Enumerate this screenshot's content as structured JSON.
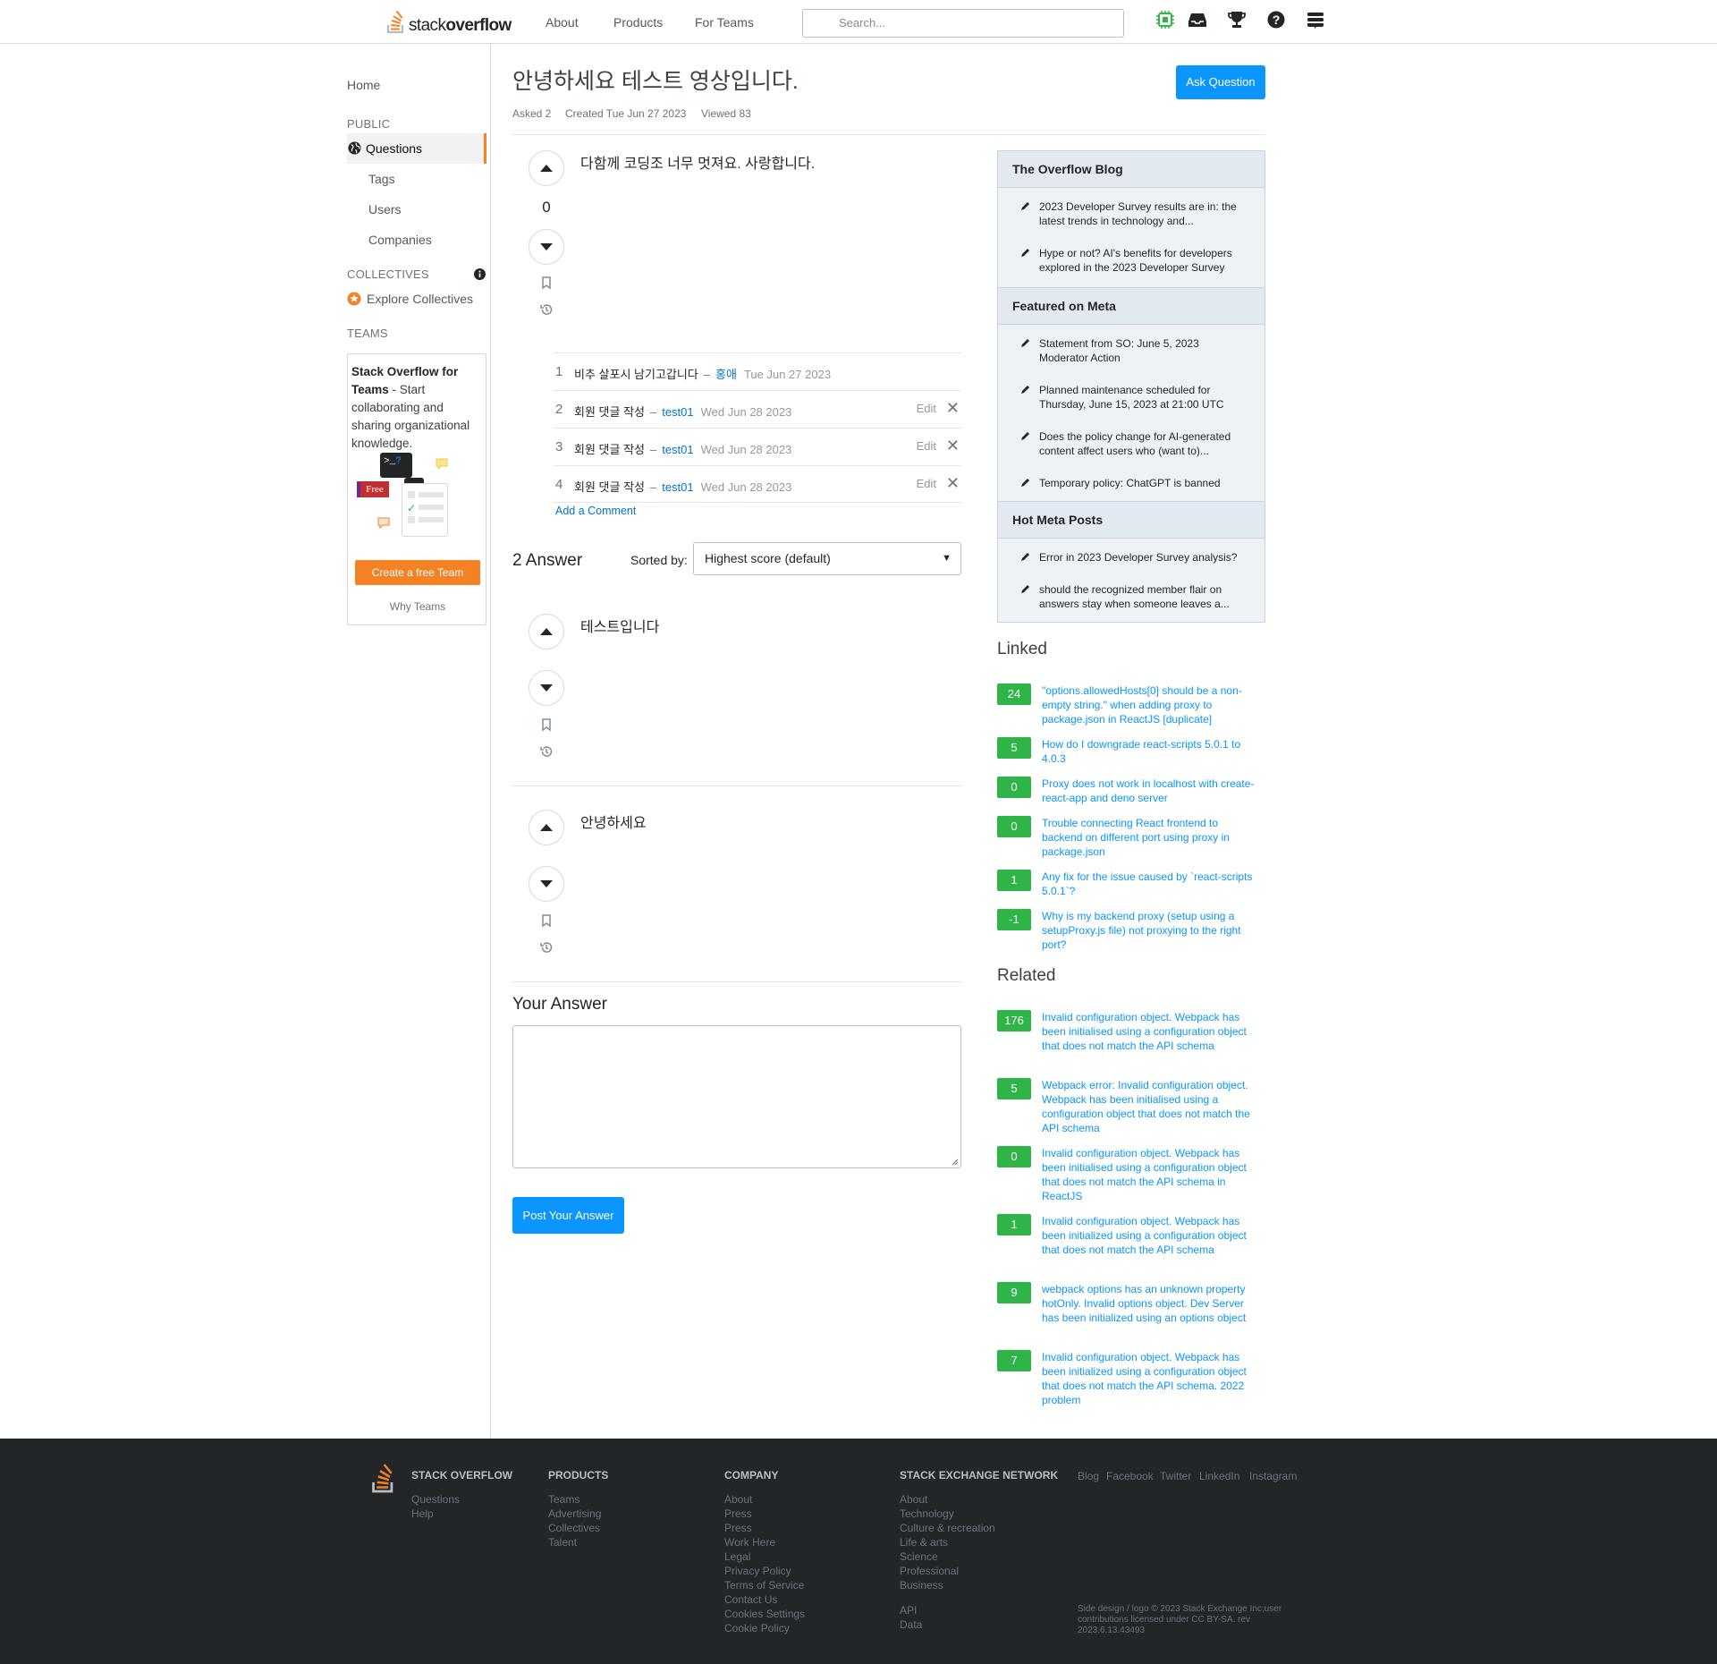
{
  "header": {
    "logo_text_light": "stack",
    "logo_text_bold": "overflow",
    "nav": [
      "About",
      "Products",
      "For Teams"
    ],
    "search_placeholder": "Search..."
  },
  "leftnav": {
    "home": "Home",
    "public": "PUBLIC",
    "questions": "Questions",
    "tags": "Tags",
    "users": "Users",
    "companies": "Companies",
    "collectives": "COLLECTIVES",
    "explore_collectives": "Explore Collectives",
    "teams": "TEAMS",
    "teams_title": "Stack Overflow for Teams",
    "teams_desc": " - Start collaborating and sharing organizational knowledge.",
    "free_badge": "Free",
    "create_team": "Create a free Team",
    "why_teams": "Why Teams"
  },
  "question": {
    "title": "안녕하세요 테스트 영상입니다.",
    "asked": "Asked 2",
    "created": "Created Tue Jun 27 2023",
    "viewed": "Viewed 83",
    "ask_button": "Ask Question",
    "votes": "0",
    "body": "다함께 코딩조 너무 멋져요. 사랑합니다."
  },
  "comments": [
    {
      "num": "1",
      "text": "비추 살포시 남기고갑니다",
      "user": "홍애",
      "date": "Tue Jun 27 2023",
      "edit": "",
      "close": ""
    },
    {
      "num": "2",
      "text": "회원 댓글 작성",
      "user": "test01",
      "date": "Wed Jun 28 2023",
      "edit": "Edit",
      "close": "✕"
    },
    {
      "num": "3",
      "text": "회원 댓글 작성",
      "user": "test01",
      "date": "Wed Jun 28 2023",
      "edit": "Edit",
      "close": "✕"
    },
    {
      "num": "4",
      "text": "회원 댓글 작성",
      "user": "test01",
      "date": "Wed Jun 28 2023",
      "edit": "Edit",
      "close": "✕"
    }
  ],
  "comment_separator": "–",
  "add_comment": "Add a Comment",
  "answers_section": {
    "count_label": "2 Answer",
    "sorted_by": "Sorted by:",
    "sort_value": "Highest score (default)",
    "answers": [
      {
        "body": "테스트입니다"
      },
      {
        "body": "안녕하세요"
      }
    ]
  },
  "your_answer": {
    "heading": "Your Answer",
    "post_button": "Post Your Answer"
  },
  "sidebar": {
    "blog_title": "The Overflow Blog",
    "blog_items": [
      "2023 Developer Survey results are in: the latest trends in technology and...",
      "Hype or not? AI's benefits for developers explored in the 2023 Developer Survey"
    ],
    "meta_title": "Featured on Meta",
    "meta_items": [
      "Statement from SO: June 5, 2023 Moderator Action",
      "Planned maintenance scheduled for Thursday, June 15, 2023 at 21:00 UTC",
      "Does the policy change for AI-generated content affect users who (want to)...",
      "Temporary policy: ChatGPT is banned"
    ],
    "hot_title": "Hot Meta Posts",
    "hot_items": [
      "Error in 2023 Developer Survey analysis?",
      "should the recognized member flair on answers stay when someone leaves a..."
    ],
    "linked_title": "Linked",
    "linked": [
      {
        "score": "24",
        "title": "\"options.allowedHosts[0] should be a non-empty string.\" when adding proxy to package.json in ReactJS [duplicate]"
      },
      {
        "score": "5",
        "title": "How do I downgrade react-scripts 5.0.1 to 4.0.3"
      },
      {
        "score": "0",
        "title": "Proxy does not work in localhost with create-react-app and deno server"
      },
      {
        "score": "0",
        "title": "Trouble connecting React frontend to backend on different port using proxy in package.json"
      },
      {
        "score": "1",
        "title": "Any fix for the issue caused by `react-scripts 5.0.1`?"
      },
      {
        "score": "-1",
        "title": "Why is my backend proxy (setup using a setupProxy.js file) not proxying to the right port?"
      }
    ],
    "related_title": "Related",
    "related": [
      {
        "score": "176",
        "title": "Invalid configuration object. Webpack has been initialised using a configuration object that does not match the API schema"
      },
      {
        "score": "5",
        "title": "Webpack error: Invalid configuration object. Webpack has been initialised using a configuration object that does not match the API schema"
      },
      {
        "score": "0",
        "title": "Invalid configuration object. Webpack has been initialised using a configuration object that does not match the API schema in ReactJS"
      },
      {
        "score": "1",
        "title": "Invalid configuration object. Webpack has been initialized using a configuration object that does not match the API schema"
      },
      {
        "score": "9",
        "title": "webpack options has an unknown property hotOnly. Invalid options object. Dev Server has been initialized using an options object"
      },
      {
        "score": "7",
        "title": "Invalid configuration object. Webpack has been initialized using a configuration object that does not match the API schema. 2022 problem"
      }
    ]
  },
  "footer": {
    "so_title": "STACK OVERFLOW",
    "so_links": [
      "Questions",
      "Help"
    ],
    "products_title": "PRODUCTS",
    "products_links": [
      "Teams",
      "Advertising",
      "Collectives",
      "Talent"
    ],
    "company_title": "COMPANY",
    "company_links": [
      "About",
      "Press",
      "Press",
      "Work Here",
      "Legal",
      "Privacy Policy",
      "Terms of Service",
      "Contact Us",
      "Cookies Settings",
      "Cookie Policy"
    ],
    "network_title": "STACK EXCHANGE NETWORK",
    "network_links": [
      "About",
      "Technology",
      "Culture & recreation",
      "Life & arts",
      "Science",
      "Professional",
      "Business"
    ],
    "network_links2": [
      "API",
      "Data"
    ],
    "social": [
      "Blog",
      "Facebook",
      "Twitter",
      "LinkedIn",
      "Instagram"
    ],
    "copyright": "Side design / logo © 2023 Stack Exchange Inc;user contributions licensed under CC BY-SA. rev 2023.6.13.43493"
  },
  "colors": {
    "accent_orange": "#f48225",
    "accent_blue": "#0a95ff",
    "score_green": "#2fb547",
    "footer_bg": "#232629"
  }
}
